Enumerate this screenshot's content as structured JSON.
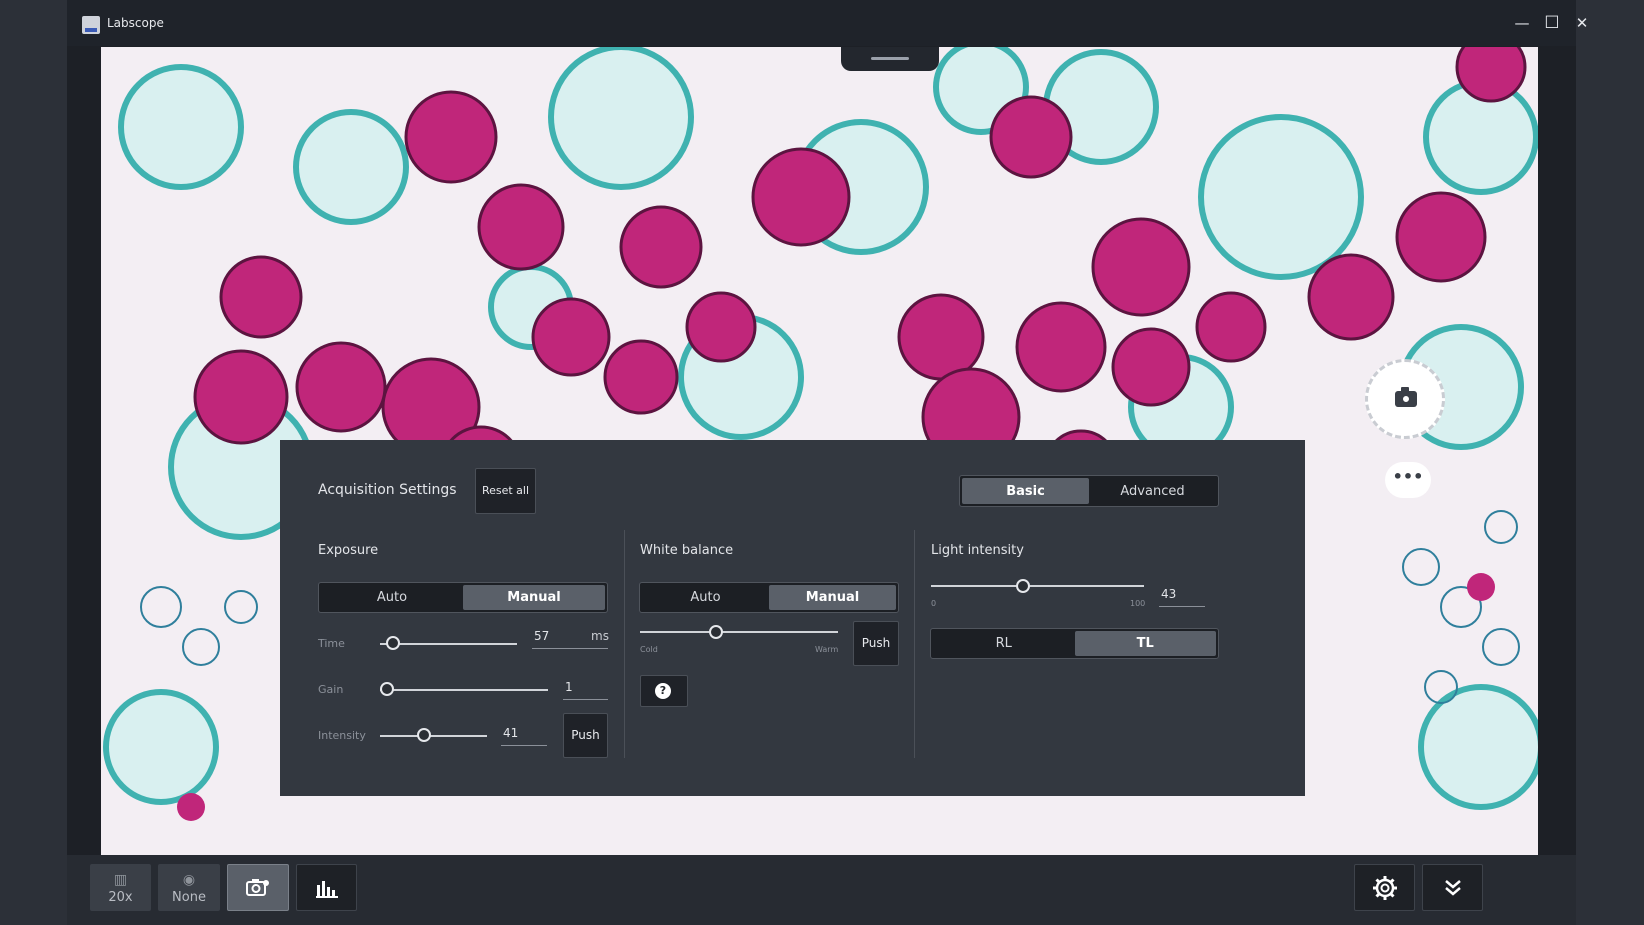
{
  "window": {
    "title": "Labscope"
  },
  "window_controls": {
    "minimize": "—",
    "maximize": "☐",
    "close": "✕"
  },
  "viewer": {
    "more_label": "•••"
  },
  "panel": {
    "title": "Acquisition Settings",
    "reset_label": "Reset all",
    "mode_tabs": [
      {
        "label": "Basic",
        "active": true
      },
      {
        "label": "Advanced",
        "active": false
      }
    ],
    "exposure": {
      "heading": "Exposure",
      "mode": [
        {
          "label": "Auto",
          "active": false
        },
        {
          "label": "Manual",
          "active": true
        }
      ],
      "time": {
        "label": "Time",
        "value": "57",
        "unit": "ms"
      },
      "gain": {
        "label": "Gain",
        "value": "1"
      },
      "intensity": {
        "label": "Intensity",
        "value": "41",
        "push_label": "Push"
      }
    },
    "white_balance": {
      "heading": "White balance",
      "mode": [
        {
          "label": "Auto",
          "active": false
        },
        {
          "label": "Manual",
          "active": true
        }
      ],
      "min_label": "Cold",
      "max_label": "Warm",
      "push_label": "Push",
      "help_label": "?"
    },
    "light": {
      "heading": "Light intensity",
      "value": "43",
      "min_label": "0",
      "max_label": "100",
      "mode": [
        {
          "label": "RL",
          "active": false
        },
        {
          "label": "TL",
          "active": true
        }
      ]
    }
  },
  "bottom_bar": {
    "objective_label": "20x",
    "filter_label": "None"
  },
  "colors": {
    "accent": "#5a6069",
    "panel": "#333840",
    "stain_magenta": "#c0267a",
    "stain_teal": "#3fb2b0"
  }
}
